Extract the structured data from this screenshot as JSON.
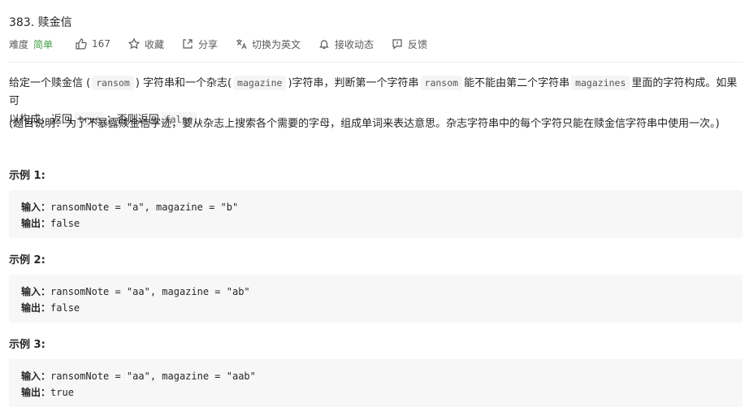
{
  "problem": {
    "title": "383. 赎金信",
    "difficulty_label": "难度",
    "difficulty": "简单",
    "likes": "167",
    "actions": {
      "favorite": "收藏",
      "share": "分享",
      "switch_lang": "切换为英文",
      "notify": "接收动态",
      "feedback": "反馈"
    },
    "accent_colors": {
      "easy": "#43a047"
    }
  },
  "description": {
    "p1_a": "给定一个赎金信 (",
    "p1_code1": "ransom",
    "p1_b": ") 字符串和一个杂志(",
    "p1_code2": "magazine",
    "p1_c": ")字符串，判断第一个字符串",
    "p1_code3": "ransom",
    "p1_d": "能不能由第二个字符串",
    "p1_code4": "magazines",
    "p1_e": "里面的字符构成。如果可",
    "p2_a": "以构成，返回",
    "p2_code1": "true",
    "p2_b": "；否则返回",
    "p2_code2": "false",
    "p2_c": "。",
    "note": "(题目说明：为了不暴露赎金信字迹，要从杂志上搜索各个需要的字母，组成单词来表达意思。杂志字符串中的每个字符只能在赎金信字符串中使用一次。)"
  },
  "examples": [
    {
      "heading": "示例 1:",
      "input_label": "输入：",
      "input": "ransomNote = \"a\", magazine = \"b\"",
      "output_label": "输出：",
      "output": "false"
    },
    {
      "heading": "示例 2:",
      "input_label": "输入：",
      "input": "ransomNote = \"aa\", magazine = \"ab\"",
      "output_label": "输出：",
      "output": "false"
    },
    {
      "heading": "示例 3:",
      "input_label": "输入：",
      "input": "ransomNote = \"aa\", magazine = \"aab\"",
      "output_label": "输出：",
      "output": "true"
    }
  ]
}
